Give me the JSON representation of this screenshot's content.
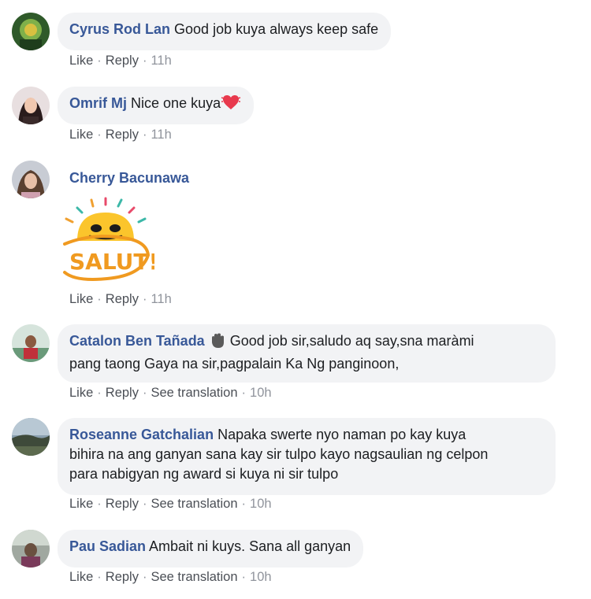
{
  "comments": [
    {
      "author": "Cyrus Rod Lan",
      "text": "Good job kuya always keep safe",
      "like": "Like",
      "reply": "Reply",
      "time": "11h"
    },
    {
      "author": "Omrif Mj",
      "text": "Nice one kuya",
      "like": "Like",
      "reply": "Reply",
      "time": "11h",
      "emoji": "sparkling-heart-icon"
    },
    {
      "author": "Cherry Bacunawa",
      "sticker_text": "SALUT!",
      "like": "Like",
      "reply": "Reply",
      "time": "11h"
    },
    {
      "author": "Catalon Ben Tañada",
      "text_line1": "Good job sir,saludo aq say,sna maràmi",
      "text_line2": "pang taong Gaya na sir,pagpalain Ka Ng panginoon,",
      "like": "Like",
      "reply": "Reply",
      "see_translation": "See translation",
      "time": "10h",
      "emoji": "waving-hand-icon"
    },
    {
      "author": "Roseanne Gatchalian",
      "text_line1": "Napaka swerte nyo naman po kay kuya",
      "text_line2": "bihira na ang ganyan sana kay sir tulpo kayo nagsaulian ng celpon",
      "text_line3": "para nabigyan ng award si kuya ni sir tulpo",
      "like": "Like",
      "reply": "Reply",
      "see_translation": "See translation",
      "time": "10h"
    },
    {
      "author": "Pau Sadian",
      "text": "Ambait ni kuys. Sana all ganyan",
      "like": "Like",
      "reply": "Reply",
      "see_translation": "See translation",
      "time": "10h"
    }
  ],
  "separator": "·"
}
